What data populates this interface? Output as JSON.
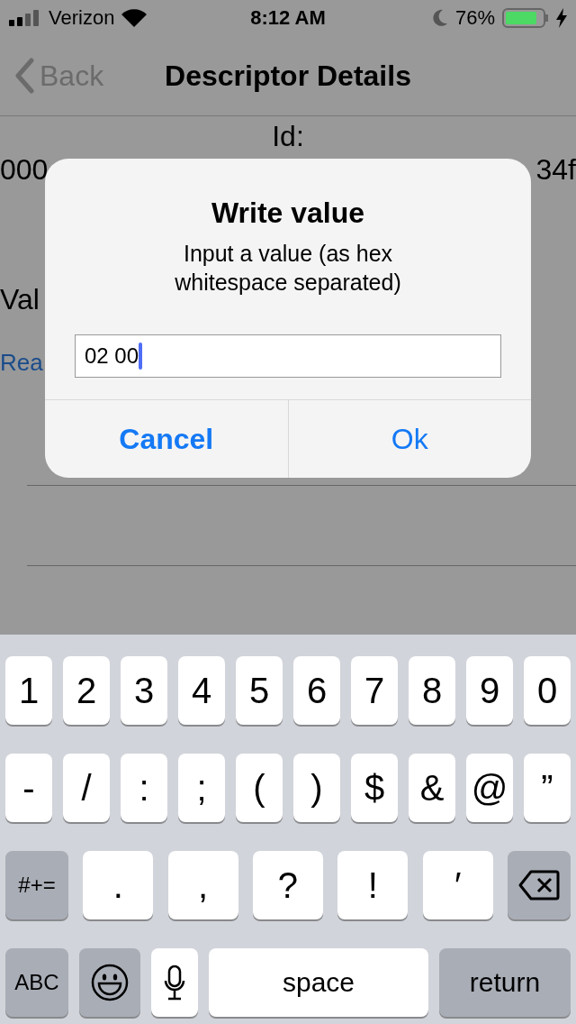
{
  "status_bar": {
    "carrier": "Verizon",
    "time": "8:12 AM",
    "battery": "76%",
    "charging": true,
    "do_not_disturb": true
  },
  "nav": {
    "back": "Back",
    "title": "Descriptor Details"
  },
  "details": {
    "id_label": "Id:",
    "id_start": "000",
    "id_end": "34f",
    "value_label": "Val",
    "read_link": "Rea"
  },
  "dialog": {
    "title": "Write value",
    "message": "Input a value (as hex whitespace separated)",
    "field_value": "02 00",
    "buttons": [
      {
        "label": "Cancel",
        "bold": true
      },
      {
        "label": "Ok",
        "bold": false
      }
    ]
  },
  "keyboard": {
    "rows": [
      {
        "keys": [
          {
            "kind": "char",
            "label": "1"
          },
          {
            "kind": "char",
            "label": "2"
          },
          {
            "kind": "char",
            "label": "3"
          },
          {
            "kind": "char",
            "label": "4"
          },
          {
            "kind": "char",
            "label": "5"
          },
          {
            "kind": "char",
            "label": "6"
          },
          {
            "kind": "char",
            "label": "7"
          },
          {
            "kind": "char",
            "label": "8"
          },
          {
            "kind": "char",
            "label": "9"
          },
          {
            "kind": "char",
            "label": "0"
          }
        ]
      },
      {
        "keys": [
          {
            "kind": "char",
            "label": "-"
          },
          {
            "kind": "char",
            "label": "/"
          },
          {
            "kind": "char",
            "label": ":"
          },
          {
            "kind": "char",
            "label": ";"
          },
          {
            "kind": "char",
            "label": "("
          },
          {
            "kind": "char",
            "label": ")"
          },
          {
            "kind": "char",
            "label": "$"
          },
          {
            "kind": "char",
            "label": "&"
          },
          {
            "kind": "char",
            "label": "@"
          },
          {
            "kind": "char",
            "label": "”"
          }
        ]
      },
      {
        "keys": [
          {
            "kind": "function",
            "label": "#+="
          },
          {
            "kind": "wide",
            "label": "."
          },
          {
            "kind": "wide",
            "label": ","
          },
          {
            "kind": "wide",
            "label": "?"
          },
          {
            "kind": "wide",
            "label": "!"
          },
          {
            "kind": "wide",
            "label": "′"
          },
          {
            "kind": "delete"
          }
        ]
      },
      {
        "keys": [
          {
            "kind": "function",
            "label": "ABC"
          },
          {
            "kind": "emoji"
          },
          {
            "kind": "mic"
          },
          {
            "kind": "space",
            "label": "space"
          },
          {
            "kind": "return",
            "label": "return"
          }
        ]
      }
    ]
  }
}
